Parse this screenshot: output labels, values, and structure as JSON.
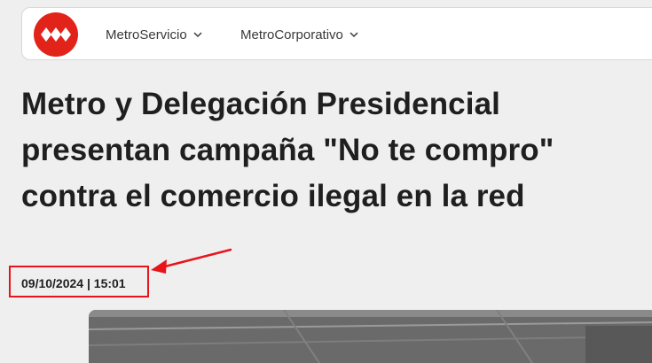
{
  "brand": {
    "logo_name": "metro-santiago-logo",
    "color": "#e2231a"
  },
  "nav": {
    "items": [
      {
        "label": "MetroServicio",
        "icon": "chevron-down-icon"
      },
      {
        "label": "MetroCorporativo",
        "icon": "chevron-down-icon"
      }
    ]
  },
  "article": {
    "title": "Metro y Delegación Presidencial presentan campaña \"No te compro\" contra el comercio ilegal en la red",
    "date": "09/10/2024",
    "separator": "|",
    "time": "15:01"
  },
  "annotation": {
    "color": "#e8141b",
    "shapes": [
      "highlight-box",
      "arrow"
    ]
  }
}
